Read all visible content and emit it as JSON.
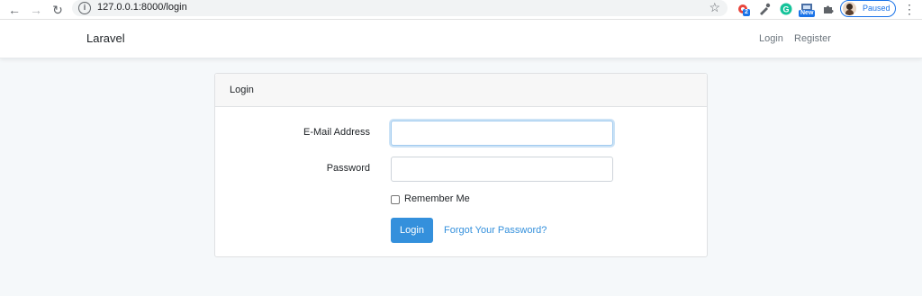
{
  "browser": {
    "url": "127.0.0.1:8000/login",
    "profile_status": "Paused",
    "ext_badge_count": "2",
    "ext_new_badge": "New"
  },
  "navbar": {
    "brand": "Laravel",
    "links": [
      "Login",
      "Register"
    ]
  },
  "card": {
    "header": "Login",
    "email_label": "E-Mail Address",
    "email_value": "",
    "password_label": "Password",
    "password_value": "",
    "remember_label": "Remember Me",
    "login_button": "Login",
    "forgot_link": "Forgot Your Password?"
  },
  "colors": {
    "primary": "#3490dc",
    "background": "#f5f8fa"
  }
}
